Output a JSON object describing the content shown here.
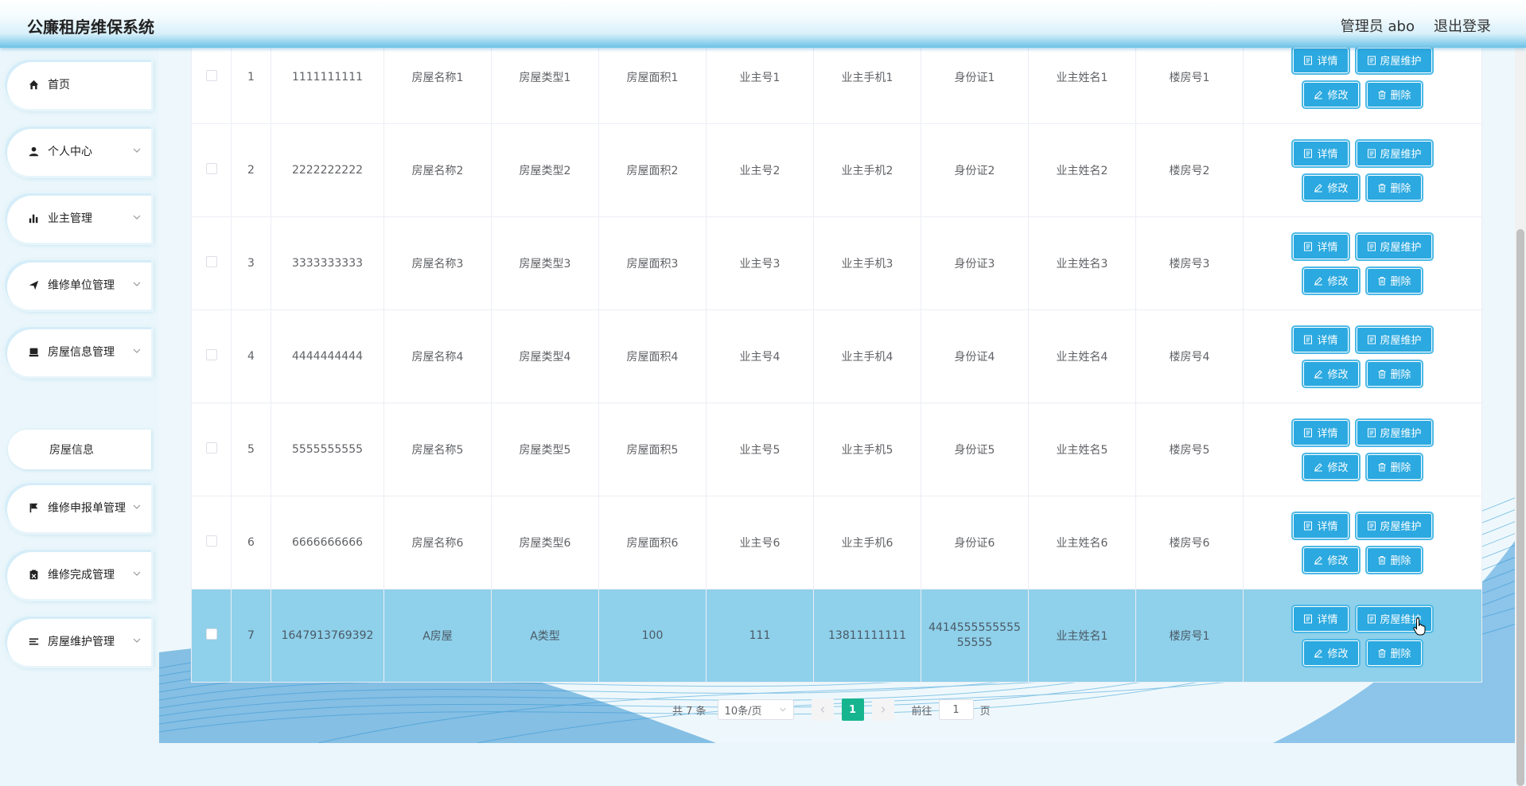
{
  "app": {
    "title": "公廉租房维保系统"
  },
  "header": {
    "admin_label": "管理员 abo",
    "logout_label": "退出登录"
  },
  "sidebar": {
    "items": [
      {
        "label": "首页",
        "icon": "home-icon",
        "has_chevron": false
      },
      {
        "label": "个人中心",
        "icon": "user-icon",
        "has_chevron": true
      },
      {
        "label": "业主管理",
        "icon": "bar-chart-icon",
        "has_chevron": true
      },
      {
        "label": "维修单位管理",
        "icon": "send-icon",
        "has_chevron": true
      },
      {
        "label": "房屋信息管理",
        "icon": "building-icon",
        "has_chevron": true
      },
      {
        "label": "维修申报单管理",
        "icon": "flag-icon",
        "has_chevron": true
      },
      {
        "label": "维修完成管理",
        "icon": "clipboard-icon",
        "has_chevron": true
      },
      {
        "label": "房屋维护管理",
        "icon": "list-icon",
        "has_chevron": true
      }
    ],
    "submenu": {
      "label": "房屋信息",
      "parent": "房屋信息管理"
    }
  },
  "table": {
    "rows": [
      {
        "index": "1",
        "code": "1111111111",
        "name": "房屋名称1",
        "type": "房屋类型1",
        "area": "房屋面积1",
        "owner_no": "业主号1",
        "phone": "业主手机1",
        "id_card": "身份证1",
        "owner_name": "业主姓名1",
        "building": "楼房号1"
      },
      {
        "index": "2",
        "code": "2222222222",
        "name": "房屋名称2",
        "type": "房屋类型2",
        "area": "房屋面积2",
        "owner_no": "业主号2",
        "phone": "业主手机2",
        "id_card": "身份证2",
        "owner_name": "业主姓名2",
        "building": "楼房号2"
      },
      {
        "index": "3",
        "code": "3333333333",
        "name": "房屋名称3",
        "type": "房屋类型3",
        "area": "房屋面积3",
        "owner_no": "业主号3",
        "phone": "业主手机3",
        "id_card": "身份证3",
        "owner_name": "业主姓名3",
        "building": "楼房号3"
      },
      {
        "index": "4",
        "code": "4444444444",
        "name": "房屋名称4",
        "type": "房屋类型4",
        "area": "房屋面积4",
        "owner_no": "业主号4",
        "phone": "业主手机4",
        "id_card": "身份证4",
        "owner_name": "业主姓名4",
        "building": "楼房号4"
      },
      {
        "index": "5",
        "code": "5555555555",
        "name": "房屋名称5",
        "type": "房屋类型5",
        "area": "房屋面积5",
        "owner_no": "业主号5",
        "phone": "业主手机5",
        "id_card": "身份证5",
        "owner_name": "业主姓名5",
        "building": "楼房号5"
      },
      {
        "index": "6",
        "code": "6666666666",
        "name": "房屋名称6",
        "type": "房屋类型6",
        "area": "房屋面积6",
        "owner_no": "业主号6",
        "phone": "业主手机6",
        "id_card": "身份证6",
        "owner_name": "业主姓名6",
        "building": "楼房号6"
      },
      {
        "index": "7",
        "code": "1647913769392",
        "name": "A房屋",
        "type": "A类型",
        "area": "100",
        "owner_no": "111",
        "phone": "13811111111",
        "id_card": "441455555555555555",
        "owner_name": "业主姓名1",
        "building": "楼房号1",
        "highlighted": true
      }
    ],
    "actions": {
      "detail": "详情",
      "maintain": "房屋维护",
      "edit": "修改",
      "delete": "删除"
    }
  },
  "pagination": {
    "total_label": "共 7 条",
    "page_size": "10条/页",
    "current_page": "1",
    "goto_prefix": "前往",
    "goto_value": "1",
    "goto_suffix": "页"
  },
  "colors": {
    "accent": "#2ba9e0",
    "active_page": "#16b58f",
    "highlight_row": "#8fd0ea"
  }
}
